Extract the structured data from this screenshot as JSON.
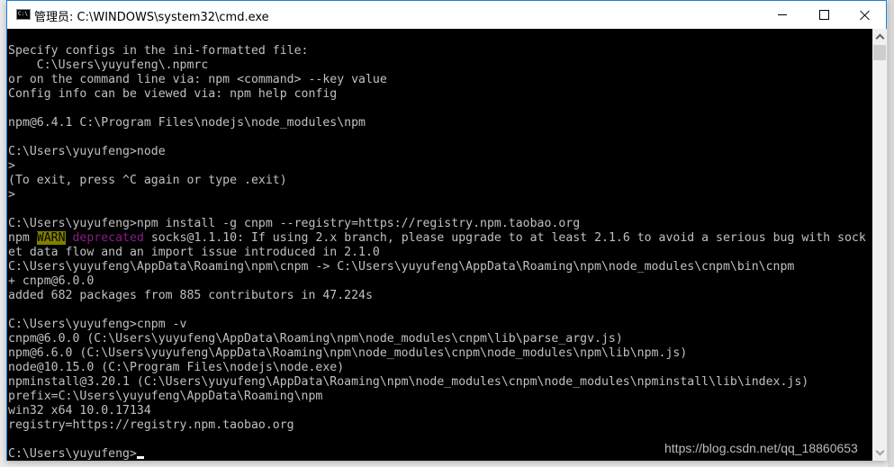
{
  "window": {
    "title": "管理员: C:\\WINDOWS\\system32\\cmd.exe",
    "icon": "cmd-icon",
    "controls": {
      "minimize": "minimize-icon",
      "maximize": "maximize-icon",
      "close": "close-icon"
    }
  },
  "console": {
    "lines": [
      "",
      "Specify configs in the ini-formatted file:",
      "    C:\\Users\\yuyufeng\\.npmrc",
      "or on the command line via: npm <command> --key value",
      "Config info can be viewed via: npm help config",
      "",
      "npm@6.4.1 C:\\Program Files\\nodejs\\node_modules\\npm",
      "",
      "C:\\Users\\yuyufeng>node",
      ">",
      "(To exit, press ^C again or type .exit)",
      ">",
      "",
      "C:\\Users\\yuyufeng>npm install -g cnpm --registry=https://registry.npm.taobao.org",
      null,
      "et data flow and an import issue introduced in 2.1.0",
      "C:\\Users\\yuyufeng\\AppData\\Roaming\\npm\\cnpm -> C:\\Users\\yuyufeng\\AppData\\Roaming\\npm\\node_modules\\cnpm\\bin\\cnpm",
      "+ cnpm@6.0.0",
      "added 682 packages from 885 contributors in 47.224s",
      "",
      "C:\\Users\\yuyufeng>cnpm -v",
      "cnpm@6.0.0 (C:\\Users\\yuyufeng\\AppData\\Roaming\\npm\\node_modules\\cnpm\\lib\\parse_argv.js)",
      "npm@6.6.0 (C:\\Users\\yuyufeng\\AppData\\Roaming\\npm\\node_modules\\cnpm\\node_modules\\npm\\lib\\npm.js)",
      "node@10.15.0 (C:\\Program Files\\nodejs\\node.exe)",
      "npminstall@3.20.1 (C:\\Users\\yuyufeng\\AppData\\Roaming\\npm\\node_modules\\cnpm\\node_modules\\npminstall\\lib\\index.js)",
      "prefix=C:\\Users\\yuyufeng\\AppData\\Roaming\\npm",
      "win32 x64 10.0.17134",
      "registry=https://registry.npm.taobao.org",
      "",
      null
    ],
    "warn_line": {
      "prefix": "npm ",
      "level": "WARN",
      "tag": "deprecated",
      "message": " socks@1.1.10: If using 2.x branch, please upgrade to at least 2.1.6 to avoid a serious bug with sock"
    },
    "prompt_line": {
      "prompt": "C:\\Users\\yuyufeng>"
    },
    "colors": {
      "background": "#000000",
      "foreground": "#c0c0c0",
      "warn_bg": "#808000",
      "deprecated_fg": "#8b1a8b"
    }
  },
  "watermark": "https://blog.csdn.net/qq_18860653"
}
